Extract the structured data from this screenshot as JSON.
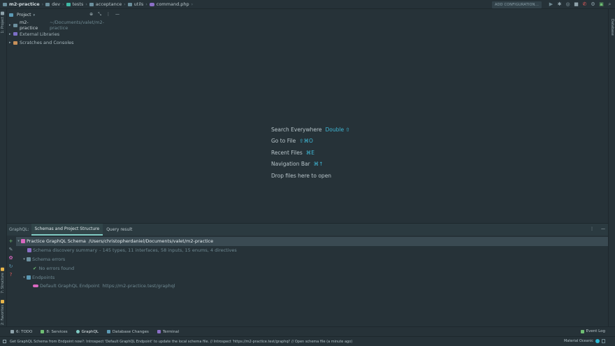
{
  "navbar": {
    "breadcrumbs": [
      {
        "label": "m2-practice",
        "icon": "folder-icon"
      },
      {
        "label": "dev",
        "icon": "folder-icon"
      },
      {
        "label": "tests",
        "icon": "folder-icon"
      },
      {
        "label": "acceptance",
        "icon": "folder-icon"
      },
      {
        "label": "utils",
        "icon": "folder-icon"
      },
      {
        "label": "command.php",
        "icon": "php-file-icon"
      }
    ],
    "add_configuration": "ADD CONFIGURATION..."
  },
  "left_stripe": {
    "project_tab": "1: Project",
    "structure_tab": "7: Structure",
    "favorites_tab": "2: Favorites"
  },
  "right_stripe": {
    "database_tab": "Database"
  },
  "project_panel": {
    "title": "Project",
    "items": [
      {
        "label": "m2-practice",
        "path": "~/Documents/valet/m2-practice"
      },
      {
        "label": "External Libraries",
        "path": ""
      },
      {
        "label": "Scratches and Consoles",
        "path": ""
      }
    ]
  },
  "editor": {
    "hints": [
      {
        "label": "Search Everywhere",
        "shortcut": "Double ⇧"
      },
      {
        "label": "Go to File",
        "shortcut": "⇧⌘O"
      },
      {
        "label": "Recent Files",
        "shortcut": "⌘E"
      },
      {
        "label": "Navigation Bar",
        "shortcut": "⌘↑"
      },
      {
        "label": "Drop files here to open",
        "shortcut": ""
      }
    ]
  },
  "graphql": {
    "label": "GraphQL:",
    "tabs": [
      "Schemas and Project Structure",
      "Query result"
    ],
    "tree": {
      "root": "Practice GraphQL Schema",
      "root_path": "/Users/christopherdaniel/Documents/valet/m2-practice",
      "summary": "Schema discovery summary",
      "summary_detail": "- 145 types, 11 interfaces, 58 inputs, 15 enums, 4 directives",
      "errors_folder": "Schema errors",
      "no_errors": "No errors found",
      "endpoints_folder": "Endpoints",
      "endpoint_name": "Default GraphQL Endpoint",
      "endpoint_url": "https://m2-practice.test/graphql"
    }
  },
  "bottom_tabs": {
    "todo": "6: TODO",
    "services": "8: Services",
    "graphql": "GraphQL",
    "db_changes": "Database Changes",
    "terminal": "Terminal",
    "event_log": "Event Log"
  },
  "statusbar": {
    "message": "Get GraphQL Schema from Endpoint now?: Introspect 'Default GraphQL Endpoint' to update the local schema file. // Introspect 'https://m2-practice.test/graphql' // Open schema file (a minute ago)",
    "theme": "Material Oceanic"
  },
  "colors": {
    "background": "#263238",
    "accent": "#80cbc4",
    "shortcut": "#3fb8d6",
    "selection": "#3a4a52"
  }
}
